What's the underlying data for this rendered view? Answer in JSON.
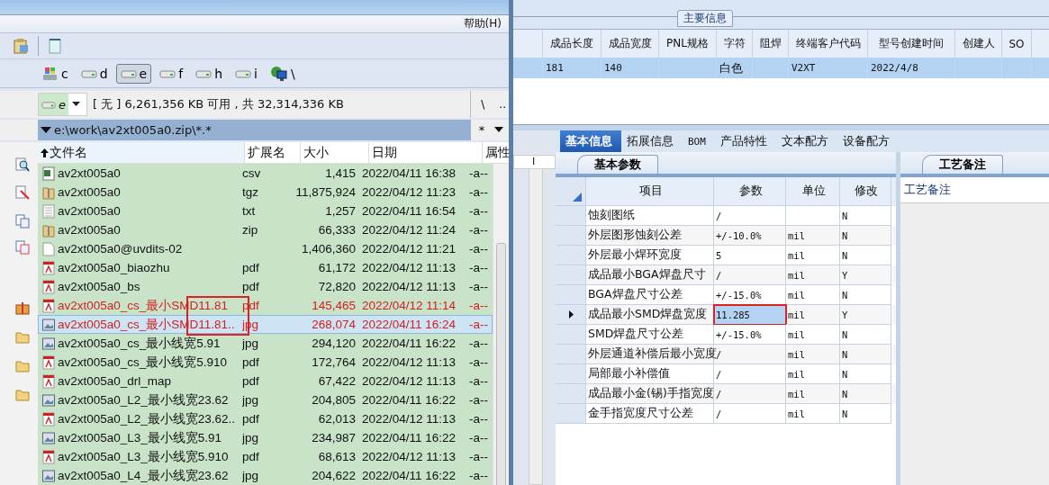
{
  "left_window": {
    "menu": [
      "帮助(H)"
    ],
    "drives": [
      {
        "letter": "c",
        "kind": "system",
        "selected": false
      },
      {
        "letter": "d",
        "kind": "disk",
        "selected": false
      },
      {
        "letter": "e",
        "kind": "disk",
        "selected": true
      },
      {
        "letter": "f",
        "kind": "disk",
        "selected": false
      },
      {
        "letter": "h",
        "kind": "disk",
        "selected": false
      },
      {
        "letter": "i",
        "kind": "disk",
        "selected": false
      },
      {
        "letter": "\\",
        "kind": "network",
        "selected": false
      }
    ],
    "drive_select": "e",
    "drive_info": "[ 无 ]  6,261,356 KB 可用 , 共 32,314,336 KB",
    "nav_buttons": [
      "\\",
      ".."
    ],
    "path": "e:\\work\\av2xt005a0.zip\\*.*",
    "filter": "*",
    "columns": [
      "文件名",
      "扩展名",
      "大小",
      "日期",
      "属性"
    ],
    "files": [
      {
        "name": "av2xt005a0",
        "ext": "csv",
        "size": "1,415",
        "date": "2022/04/11 16:38",
        "attr": "-a--",
        "kind": "sheet",
        "flagged": false,
        "selected": false,
        "annotated": false
      },
      {
        "name": "av2xt005a0",
        "ext": "tgz",
        "size": "11,875,924",
        "date": "2022/04/12 11:23",
        "attr": "-a--",
        "kind": "archive",
        "flagged": false,
        "selected": false,
        "annotated": false
      },
      {
        "name": "av2xt005a0",
        "ext": "txt",
        "size": "1,257",
        "date": "2022/04/11 16:54",
        "attr": "-a--",
        "kind": "text",
        "flagged": false,
        "selected": false,
        "annotated": false
      },
      {
        "name": "av2xt005a0",
        "ext": "zip",
        "size": "66,333",
        "date": "2022/04/12 11:24",
        "attr": "-a--",
        "kind": "archive",
        "flagged": false,
        "selected": false,
        "annotated": false
      },
      {
        "name": "av2xt005a0@uvdits-02",
        "size": "1,406,360",
        "date": "2022/04/12 11:21",
        "attr": "-a--",
        "kind": "blank",
        "flagged": false,
        "selected": false,
        "annotated": false
      },
      {
        "name": "av2xt005a0_biaozhu",
        "ext": "pdf",
        "size": "61,172",
        "date": "2022/04/12 11:13",
        "attr": "-a--",
        "kind": "pdf",
        "flagged": false,
        "selected": false,
        "annotated": false
      },
      {
        "name": "av2xt005a0_bs",
        "ext": "pdf",
        "size": "72,820",
        "date": "2022/04/12 11:13",
        "attr": "-a--",
        "kind": "pdf",
        "flagged": false,
        "selected": false,
        "annotated": false
      },
      {
        "name": "av2xt005a0_cs_最小SMD11.81",
        "ext": "pdf",
        "size": "145,465",
        "date": "2022/04/12 11:14",
        "attr": "-a--",
        "kind": "pdf",
        "flagged": true,
        "selected": false,
        "annotated": true
      },
      {
        "name": "av2xt005a0_cs_最小SMD11.81..",
        "ext": "jpg",
        "size": "268,074",
        "date": "2022/04/11 16:24",
        "attr": "-a--",
        "kind": "image",
        "flagged": true,
        "selected": true,
        "annotated": true
      },
      {
        "name": "av2xt005a0_cs_最小线宽5.91",
        "ext": "jpg",
        "size": "294,120",
        "date": "2022/04/11 16:22",
        "attr": "-a--",
        "kind": "image",
        "flagged": false,
        "selected": false,
        "annotated": false
      },
      {
        "name": "av2xt005a0_cs_最小线宽5.910",
        "ext": "pdf",
        "size": "172,764",
        "date": "2022/04/12 11:13",
        "attr": "-a--",
        "kind": "pdf",
        "flagged": false,
        "selected": false,
        "annotated": false
      },
      {
        "name": "av2xt005a0_drl_map",
        "ext": "pdf",
        "size": "67,422",
        "date": "2022/04/12 11:13",
        "attr": "-a--",
        "kind": "pdf",
        "flagged": false,
        "selected": false,
        "annotated": false
      },
      {
        "name": "av2xt005a0_L2_最小线宽23.62",
        "ext": "jpg",
        "size": "204,805",
        "date": "2022/04/11 16:22",
        "attr": "-a--",
        "kind": "image",
        "flagged": false,
        "selected": false,
        "annotated": false
      },
      {
        "name": "av2xt005a0_L2_最小线宽23.62..",
        "ext": "pdf",
        "size": "62,013",
        "date": "2022/04/12 11:13",
        "attr": "-a--",
        "kind": "pdf",
        "flagged": false,
        "selected": false,
        "annotated": false
      },
      {
        "name": "av2xt005a0_L3_最小线宽5.91",
        "ext": "jpg",
        "size": "234,987",
        "date": "2022/04/11 16:22",
        "attr": "-a--",
        "kind": "image",
        "flagged": false,
        "selected": false,
        "annotated": false
      },
      {
        "name": "av2xt005a0_L3_最小线宽5.910",
        "ext": "pdf",
        "size": "68,613",
        "date": "2022/04/12 11:13",
        "attr": "-a--",
        "kind": "pdf",
        "flagged": false,
        "selected": false,
        "annotated": false
      },
      {
        "name": "av2xt005a0_L4_最小线宽23.62",
        "ext": "jpg",
        "size": "204,622",
        "date": "2022/04/11 16:22",
        "attr": "-a--",
        "kind": "image",
        "flagged": false,
        "selected": false,
        "annotated": false
      }
    ]
  },
  "right_window": {
    "group_title": "主要信息",
    "columns": [
      "成品长度",
      "成品宽度",
      "PNL规格",
      "字符",
      "阻焊",
      "终端客户代码",
      "型号创建时间",
      "创建人",
      "SO"
    ],
    "rows": [
      {
        "cells": [
          "181",
          "140",
          null,
          "白色",
          null,
          "V2XT",
          "2022/4/8",
          null,
          null
        ],
        "selected": true
      }
    ],
    "side_header": "I",
    "tabs": [
      {
        "label": "基本信息",
        "selected": true
      },
      {
        "label": "拓展信息",
        "selected": false
      },
      {
        "label": "BOM",
        "selected": false
      },
      {
        "label": "产品特性",
        "selected": false
      },
      {
        "label": "文本配方",
        "selected": false
      },
      {
        "label": "设备配方",
        "selected": false
      }
    ],
    "params_tab": "基本参数",
    "param_columns": [
      "项目",
      "参数",
      "单位",
      "修改"
    ],
    "params": [
      {
        "item": "蚀刻图纸",
        "value": "/",
        "modified": "N",
        "current": false,
        "highlighted": false
      },
      {
        "item": "外层图形蚀刻公差",
        "value": "+/-10.0%",
        "unit": "mil",
        "modified": "N",
        "current": false,
        "highlighted": false
      },
      {
        "item": "外层最小焊环宽度",
        "value": "5",
        "unit": "mil",
        "modified": "N",
        "current": false,
        "highlighted": false
      },
      {
        "item": "成品最小BGA焊盘尺寸",
        "value": "/",
        "unit": "mil",
        "modified": "Y",
        "current": false,
        "highlighted": false
      },
      {
        "item": "BGA焊盘尺寸公差",
        "value": "+/-15.0%",
        "unit": "mil",
        "modified": "N",
        "current": false,
        "highlighted": false
      },
      {
        "item": "成品最小SMD焊盘宽度",
        "value": "11.285",
        "unit": "mil",
        "modified": "Y",
        "current": true,
        "highlighted": true
      },
      {
        "item": "SMD焊盘尺寸公差",
        "value": "+/-15.0%",
        "unit": "mil",
        "modified": "N",
        "current": false,
        "highlighted": false
      },
      {
        "item": "外层通道补偿后最小宽度",
        "value": "/",
        "unit": "mil",
        "modified": "N",
        "current": false,
        "highlighted": false
      },
      {
        "item": "局部最小补偿值",
        "value": "/",
        "unit": "mil",
        "modified": "N",
        "current": false,
        "highlighted": false
      },
      {
        "item": "成品最小金(锡)手指宽度",
        "value": "/",
        "unit": "mil",
        "modified": "N",
        "current": false,
        "highlighted": false
      },
      {
        "item": "金手指宽度尺寸公差",
        "value": "/",
        "unit": "mil",
        "modified": "N",
        "current": false,
        "highlighted": false
      }
    ],
    "notes_tab": "工艺备注",
    "notes_label": "工艺备注"
  }
}
